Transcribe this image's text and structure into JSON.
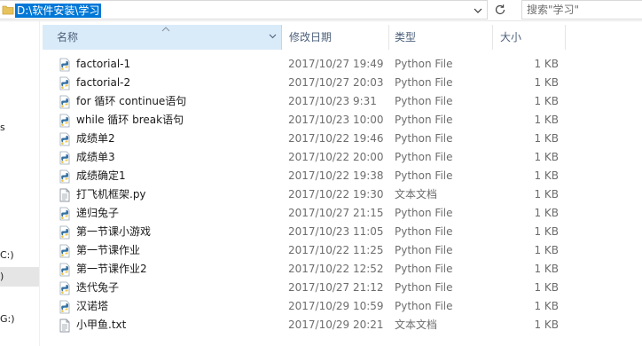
{
  "address_bar": {
    "path": "D:\\软件安装\\学习",
    "dropdown_icon": "chevron-down-icon"
  },
  "refresh_icon": "refresh-icon",
  "search": {
    "placeholder": "搜索\"学习\""
  },
  "nav": {
    "items": [
      {
        "label": "s"
      },
      {
        "label": "C:)"
      },
      {
        "label": ")"
      },
      {
        "label": "G:)"
      }
    ],
    "selected_index": 2
  },
  "columns": {
    "name": "名称",
    "date": "修改日期",
    "type": "类型",
    "size": "大小"
  },
  "files": [
    {
      "name": "factorial-1",
      "date": "2017/10/27 19:49",
      "type": "Python File",
      "size": "1 KB",
      "icon": "python-file-icon"
    },
    {
      "name": "factorial-2",
      "date": "2017/10/27 20:03",
      "type": "Python File",
      "size": "1 KB",
      "icon": "python-file-icon"
    },
    {
      "name": "for 循环 continue语句",
      "date": "2017/10/23 9:31",
      "type": "Python File",
      "size": "1 KB",
      "icon": "python-file-icon"
    },
    {
      "name": "while  循环 break语句",
      "date": "2017/10/23 10:00",
      "type": "Python File",
      "size": "1 KB",
      "icon": "python-file-icon"
    },
    {
      "name": "成绩单2",
      "date": "2017/10/22 19:46",
      "type": "Python File",
      "size": "1 KB",
      "icon": "python-file-icon"
    },
    {
      "name": "成绩单3",
      "date": "2017/10/22 20:00",
      "type": "Python File",
      "size": "1 KB",
      "icon": "python-file-icon"
    },
    {
      "name": "成绩确定1",
      "date": "2017/10/22 19:38",
      "type": "Python File",
      "size": "1 KB",
      "icon": "python-file-icon"
    },
    {
      "name": "打飞机框架.py",
      "date": "2017/10/22 19:30",
      "type": "文本文档",
      "size": "1 KB",
      "icon": "text-file-icon"
    },
    {
      "name": "递归兔子",
      "date": "2017/10/27 21:15",
      "type": "Python File",
      "size": "1 KB",
      "icon": "python-file-icon"
    },
    {
      "name": "第一节课小游戏",
      "date": "2017/10/23 11:05",
      "type": "Python File",
      "size": "1 KB",
      "icon": "python-file-icon"
    },
    {
      "name": "第一节课作业",
      "date": "2017/10/22 11:25",
      "type": "Python File",
      "size": "1 KB",
      "icon": "python-file-icon"
    },
    {
      "name": "第一节课作业2",
      "date": "2017/10/22 12:52",
      "type": "Python File",
      "size": "1 KB",
      "icon": "python-file-icon"
    },
    {
      "name": "迭代兔子",
      "date": "2017/10/27 21:12",
      "type": "Python File",
      "size": "1 KB",
      "icon": "python-file-icon"
    },
    {
      "name": "汉诺塔",
      "date": "2017/10/29 10:59",
      "type": "Python File",
      "size": "1 KB",
      "icon": "python-file-icon"
    },
    {
      "name": "小甲鱼.txt",
      "date": "2017/10/29 20:21",
      "type": "文本文档",
      "size": "1 KB",
      "icon": "text-file-icon"
    }
  ]
}
